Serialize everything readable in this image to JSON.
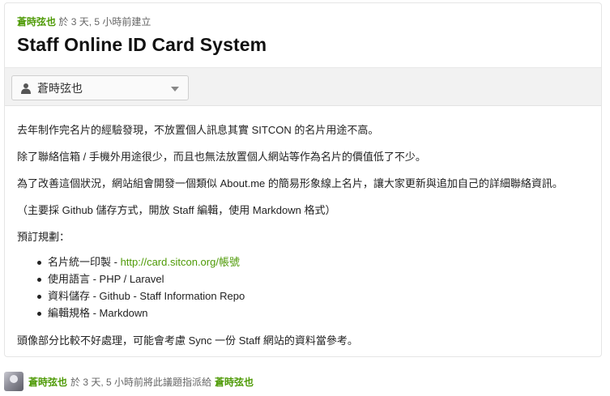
{
  "issue": {
    "author": "蒼時弦也",
    "created_meta": "於 3 天, 5 小時前建立",
    "title": "Staff Online ID Card System"
  },
  "assignee_select": {
    "selected": "蒼時弦也",
    "icon": "person-icon"
  },
  "description": {
    "p1": "去年制作完名片的經驗發現，不放置個人訊息其實 SITCON 的名片用途不高。",
    "p2": "除了聯絡信箱 / 手機外用途很少，而且也無法放置個人網站等作為名片的價值低了不少。",
    "p3": "為了改善這個狀況，網站組會開發一個類似 About.me 的簡易形象線上名片，讓大家更新與追加自己的詳細聯絡資訊。",
    "p4": "（主要採 Github 儲存方式，開放 Staff 編輯，使用 Markdown 格式）",
    "p5": "預訂規劃：",
    "list": [
      {
        "text": "名片統一印製 - ",
        "link": "http://card.sitcon.org/帳號"
      },
      {
        "text": "使用語言 - PHP / Laravel",
        "link": ""
      },
      {
        "text": "資料儲存 - Github - Staff Information Repo",
        "link": ""
      },
      {
        "text": "編輯規格 - Markdown",
        "link": ""
      }
    ],
    "p6": "頭像部分比較不好處理，可能會考慮 Sync 一份 Staff 網站的資料當參考。"
  },
  "event": {
    "actor": "蒼時弦也",
    "action": "於 3 天, 5 小時前將此議題指派給",
    "target": "蒼時弦也"
  },
  "colors": {
    "link_green": "#4e9a06",
    "bar_bg": "#f2f2f2"
  }
}
